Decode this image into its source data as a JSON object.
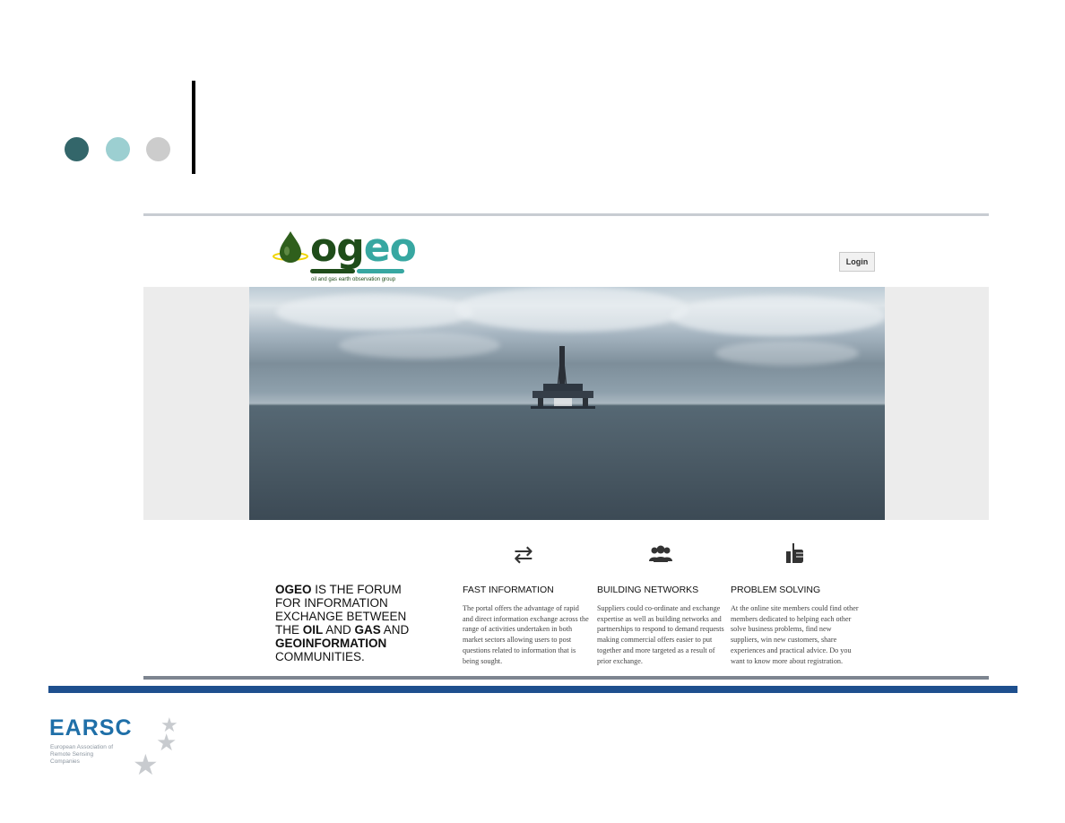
{
  "slide": {
    "colors": {
      "dot1": "#33666a",
      "dot2": "#9ccfd1",
      "dot3": "#cccccc",
      "footer_bar": "#1e4f8e",
      "brand": "#1f6fa8"
    }
  },
  "site": {
    "logo": {
      "og": "og",
      "eo": "eo",
      "tagline": "oil and gas earth observation group",
      "icon": "oil-drop-icon"
    },
    "login_label": "Login",
    "hero": {
      "icon": "offshore-rig-photo"
    },
    "headline": {
      "l1_b": "OGEO",
      "l1": " IS THE FORUM",
      "l2": "FOR INFORMATION",
      "l3": "EXCHANGE BETWEEN",
      "l4_a": "THE ",
      "l4_b": "OIL",
      "l4_c": " AND ",
      "l4_d": "GAS",
      "l4_e": " AND",
      "l5_b": "GEOINFORMATION",
      "l6": "COMMUNITIES."
    },
    "features": [
      {
        "icon": "exchange-arrows-icon",
        "title": "FAST INFORMATION",
        "text": "The portal offers the advantage of rapid and direct information exchange across the range of activities undertaken in both market sectors allowing users to post questions related to information that is being sought."
      },
      {
        "icon": "users-group-icon",
        "title": "BUILDING NETWORKS",
        "text": "Suppliers could co-ordinate and exchange expertise as well as building networks and partnerships to respond to demand requests making commercial offers easier to put together and more targeted as a result of prior exchange."
      },
      {
        "icon": "thumbs-up-icon",
        "title": "PROBLEM SOLVING",
        "text": "At the online site members could find other members dedicated to helping each other solve business problems, find new suppliers, win new customers, share experiences and practical advice. Do you want to know more about registration."
      }
    ]
  },
  "footer": {
    "brand": "EARSC",
    "sub": "European Association of Remote Sensing Companies",
    "icon": "star-icon"
  }
}
